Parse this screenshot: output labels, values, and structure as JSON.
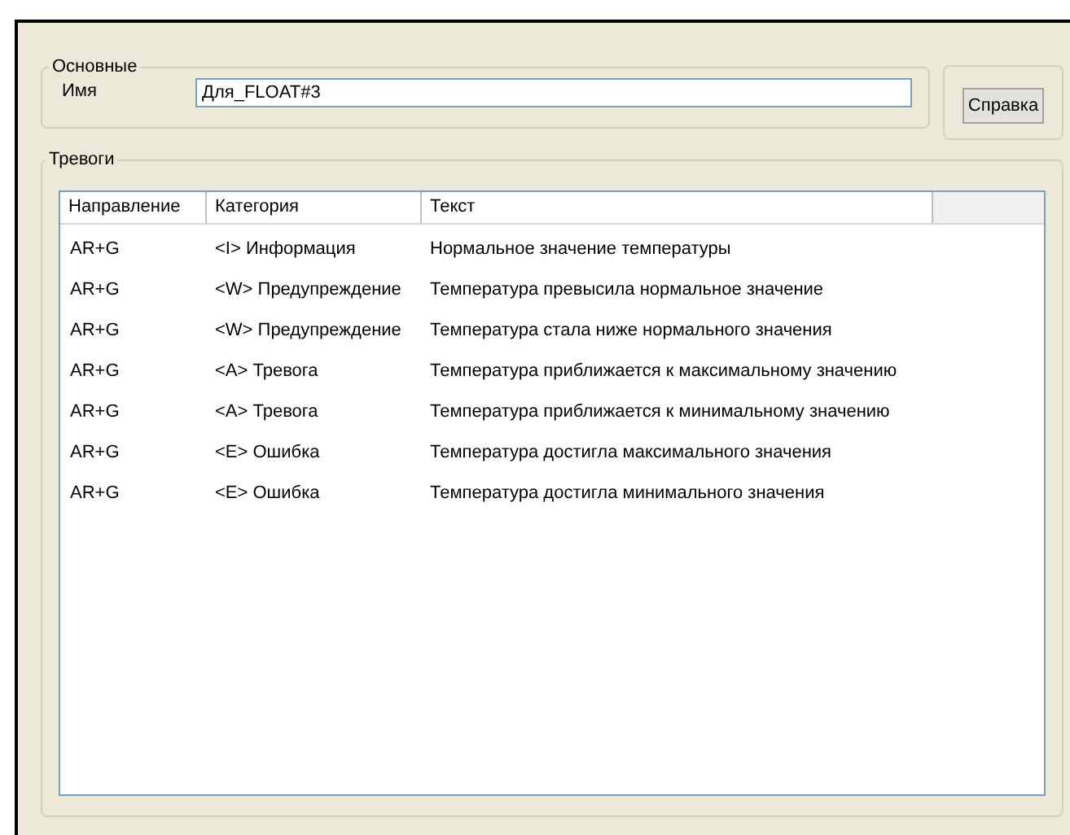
{
  "basic_group": {
    "title": "Основные",
    "name_label": "Имя",
    "name_value": "Для_FLOAT#3"
  },
  "help_button": "Справка",
  "alarms_group": {
    "title": "Тревоги",
    "table": {
      "columns": [
        "Направление",
        "Категория",
        "Текст"
      ],
      "rows": [
        {
          "direction": "AR+G",
          "category": "<I> Информация",
          "text": "Нормальное значение температуры"
        },
        {
          "direction": "AR+G",
          "category": "<W> Предупреждение",
          "text": "Температура превысила нормальное значение"
        },
        {
          "direction": "AR+G",
          "category": "<W> Предупреждение",
          "text": "Температура стала ниже нормального значения"
        },
        {
          "direction": "AR+G",
          "category": "<A> Тревога",
          "text": "Температура приближается к максимальному значению"
        },
        {
          "direction": "AR+G",
          "category": "<A> Тревога",
          "text": "Температура приближается к минимальному значению"
        },
        {
          "direction": "AR+G",
          "category": "<E> Ошибка",
          "text": "Температура достигла максимального значения"
        },
        {
          "direction": "AR+G",
          "category": "<E> Ошибка",
          "text": "Температура достигла минимального значения"
        }
      ]
    }
  }
}
